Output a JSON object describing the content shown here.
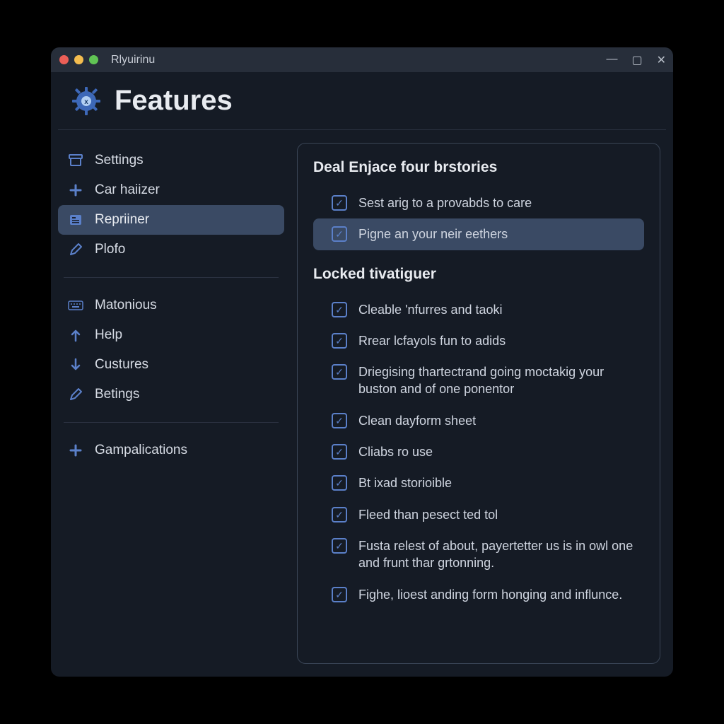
{
  "window": {
    "app_name": "Rlyuirinu",
    "title": "Features"
  },
  "sidebar": {
    "group1": [
      {
        "label": "Settings",
        "icon": "archive-icon",
        "selected": false
      },
      {
        "label": "Car haiizer",
        "icon": "plus-icon",
        "selected": false
      },
      {
        "label": "Repriiner",
        "icon": "card-icon",
        "selected": true
      },
      {
        "label": "Plofo",
        "icon": "pencil-icon",
        "selected": false
      }
    ],
    "group2": [
      {
        "label": "Matonious",
        "icon": "keyboard-icon",
        "selected": false
      },
      {
        "label": "Help",
        "icon": "arrow-up-icon",
        "selected": false
      },
      {
        "label": "Custures",
        "icon": "arrow-down-icon",
        "selected": false
      },
      {
        "label": "Betings",
        "icon": "pencil-icon",
        "selected": false
      }
    ],
    "group3": [
      {
        "label": "Gampalications",
        "icon": "plus-icon",
        "selected": false
      }
    ]
  },
  "panel": {
    "section1": {
      "title": "Deal Enjace four brstories",
      "options": [
        {
          "label": "Sest arig to a provabds to care",
          "checked": true,
          "selected": false
        },
        {
          "label": "Pigne an your neir eethers",
          "checked": true,
          "selected": true
        }
      ]
    },
    "section2": {
      "title": "Locked tivatiguer",
      "options": [
        {
          "label": "Cleable 'nfurres and taoki",
          "checked": true
        },
        {
          "label": "Rrear lcfayols fun to adids",
          "checked": true
        },
        {
          "label": "Driegising thartectrand going moctakig your buston and of one ponentor",
          "checked": true
        },
        {
          "label": "Clean dayform sheet",
          "checked": true
        },
        {
          "label": "Cliabs ro use",
          "checked": true
        },
        {
          "label": "Bt ixad storioible",
          "checked": true
        },
        {
          "label": "Fleed than pesect ted tol",
          "checked": true
        },
        {
          "label": "Fusta relest of about, payertetter us is in owl one and frunt thar grtonning.",
          "checked": true
        },
        {
          "label": "Fighe, lioest anding form honging and influnce.",
          "checked": true
        }
      ]
    }
  }
}
